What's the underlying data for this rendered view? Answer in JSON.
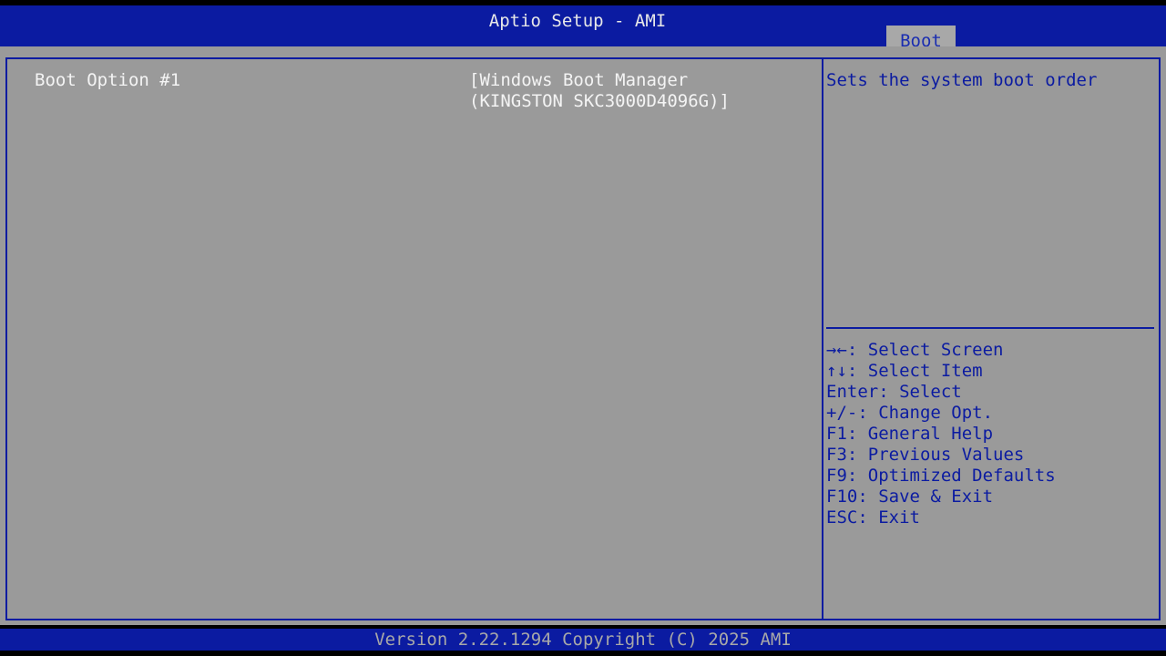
{
  "header": {
    "title": "Aptio Setup - AMI",
    "tabs": [
      {
        "label": "Boot",
        "active": true
      }
    ]
  },
  "boot_options": [
    {
      "label": "Boot Option #1",
      "value_line1": "[Windows Boot Manager",
      "value_line2": "(KINGSTON SKC3000D4096G)]"
    }
  ],
  "help": {
    "text": "Sets the system boot order",
    "keys": [
      "→←: Select Screen",
      "↑↓: Select Item",
      "Enter: Select",
      "+/-: Change Opt.",
      "F1: General Help",
      "F3: Previous Values",
      "F9: Optimized Defaults",
      "F10: Save & Exit",
      "ESC: Exit"
    ]
  },
  "footer": {
    "text": "Version 2.22.1294 Copyright (C) 2025 AMI"
  },
  "colors": {
    "header_blue": "#0b1ba1",
    "panel_gray": "#9a9a9a",
    "text_white": "#f4f4f4",
    "help_blue": "#0b1ba1",
    "footer_gray_text": "#a8a8a8"
  }
}
